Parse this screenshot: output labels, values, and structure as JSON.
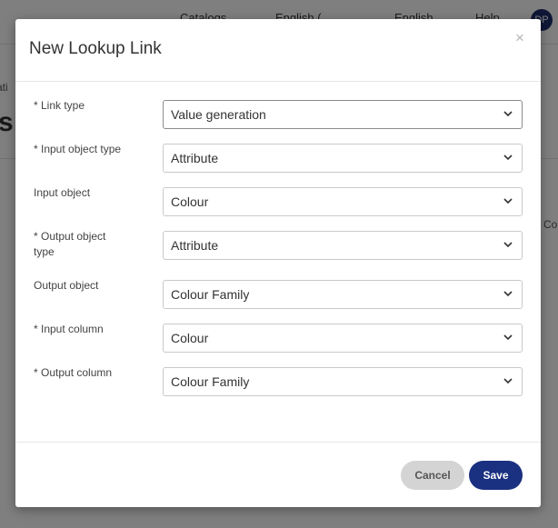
{
  "background": {
    "top_items": [
      "Catalogs",
      "English (...",
      "English",
      "Help"
    ],
    "avatar_initials": "DP",
    "crumb": "ati",
    "title": "s",
    "col_label": "Co"
  },
  "modal": {
    "title": "New Lookup Link",
    "close_symbol": "×",
    "fields": [
      {
        "label": "* Link type",
        "value": "Value generation"
      },
      {
        "label": "* Input object type",
        "value": "Attribute"
      },
      {
        "label": "Input object",
        "value": "Colour"
      },
      {
        "label": "* Output object type",
        "value": "Attribute"
      },
      {
        "label": "Output object",
        "value": "Colour Family"
      },
      {
        "label": "* Input column",
        "value": "Colour"
      },
      {
        "label": "* Output column",
        "value": "Colour Family"
      }
    ],
    "buttons": {
      "cancel": "Cancel",
      "save": "Save"
    }
  },
  "colors": {
    "primary": "#1a3080",
    "cancel_bg": "#d4d4d4",
    "overlay": "rgba(0,0,0,0.5)"
  }
}
